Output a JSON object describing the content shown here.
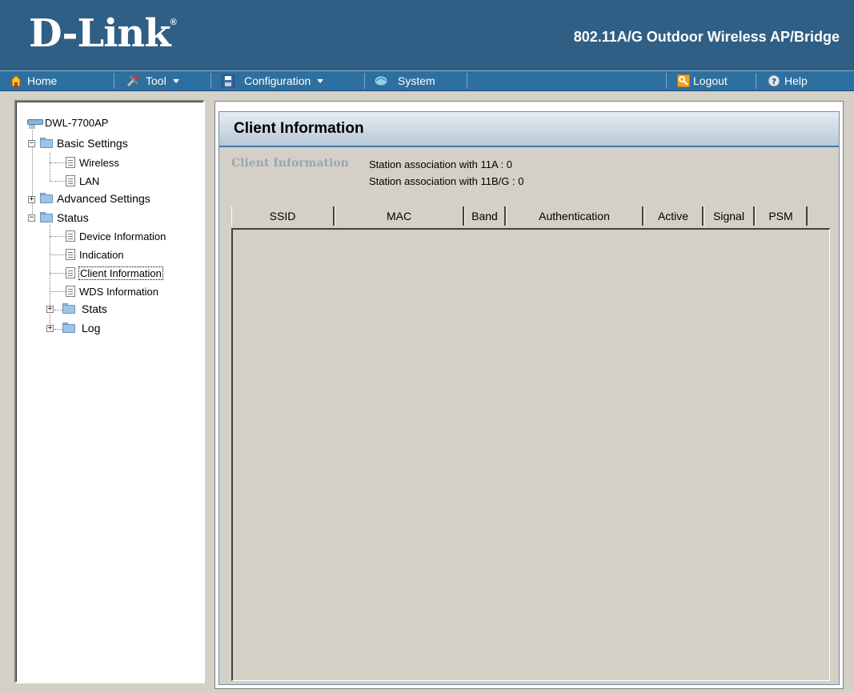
{
  "header": {
    "logo": "D-Link",
    "logo_mark": "®",
    "product_title": "802.11A/G Outdoor Wireless AP/Bridge"
  },
  "menubar": {
    "home": "Home",
    "tool": "Tool",
    "configuration": "Configuration",
    "system": "System",
    "logout": "Logout",
    "help": "Help"
  },
  "tree": {
    "root": "DWL-7700AP",
    "basic_settings": "Basic Settings",
    "wireless": "Wireless",
    "lan": "LAN",
    "advanced_settings": "Advanced Settings",
    "status": "Status",
    "device_information": "Device Information",
    "indication": "Indication",
    "client_information": "Client Information",
    "wds_information": "WDS Information",
    "stats": "Stats",
    "log": "Log"
  },
  "main": {
    "page_title": "Client Information",
    "section_label": "Client Information",
    "assoc_11a": "Station association with 11A : 0",
    "assoc_11bg": "Station association with 11B/G : 0",
    "columns": [
      "SSID",
      "MAC",
      "Band",
      "Authentication",
      "Active",
      "Signal",
      "PSM"
    ]
  },
  "colors": {
    "header_bg": "#2f5f84",
    "menubar_bg": "#2d6fa0",
    "accent": "#3f7aa8"
  }
}
